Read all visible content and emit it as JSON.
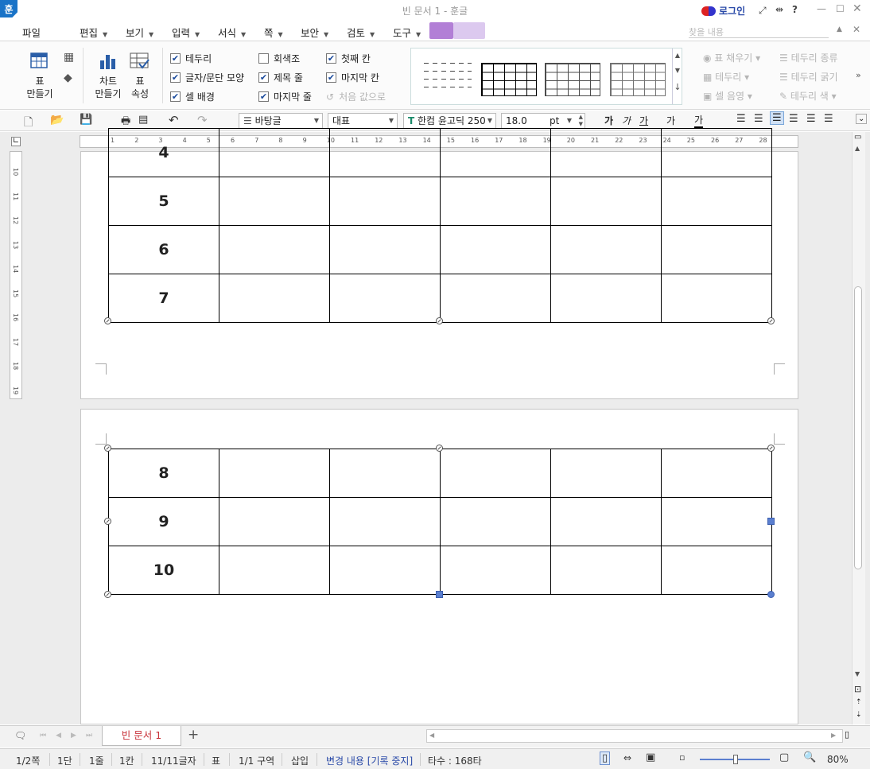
{
  "app": {
    "logo": "훈",
    "window_title": "빈 문서 1 - 훈글",
    "login": "로그인",
    "title_icons": [
      "fullscreen-icon",
      "resize-icon",
      "help-icon",
      "minimize-icon",
      "maximize-icon",
      "close-icon"
    ],
    "help": "?"
  },
  "menu": {
    "file": "파일",
    "items": [
      "편집",
      "보기",
      "입력",
      "서식",
      "쪽",
      "보안",
      "검토",
      "도구"
    ],
    "search_placeholder": "찾을 내용"
  },
  "ribbon": {
    "table_make": "표\n만들기",
    "chart_make": "차트\n만들기",
    "table_props": "표\n속성",
    "checks": [
      {
        "label": "테두리",
        "checked": true
      },
      {
        "label": "글자/문단 모양",
        "checked": true
      },
      {
        "label": "셀 배경",
        "checked": true
      },
      {
        "label": "회색조",
        "checked": false
      },
      {
        "label": "제목 줄",
        "checked": true
      },
      {
        "label": "마지막 줄",
        "checked": true
      },
      {
        "label": "첫째 칸",
        "checked": true
      },
      {
        "label": "마지막 칸",
        "checked": true
      }
    ],
    "reset": "처음 값으로",
    "right_tools": [
      "표 채우기",
      "테두리",
      "셀 음영",
      "테두리 종류",
      "테두리 굵기",
      "테두리 색"
    ]
  },
  "format": {
    "style": "바탕글",
    "lang": "대표",
    "font": "한컴 윤고딕 250",
    "size": "18.0",
    "unit": "pt",
    "char_buttons": [
      "가",
      "가",
      "가",
      "가",
      "가"
    ]
  },
  "ruler": {
    "h_ticks": [
      "1",
      "2",
      "3",
      "4",
      "5",
      "6",
      "7",
      "8",
      "9",
      "10",
      "11",
      "12",
      "13",
      "14",
      "15",
      "16",
      "17",
      "18",
      "19",
      "20",
      "21",
      "22",
      "23",
      "24",
      "25",
      "26",
      "27",
      "28"
    ],
    "v_ticks": [
      "10",
      "11",
      "12",
      "13",
      "14",
      "15",
      "16",
      "17",
      "18",
      "19"
    ]
  },
  "page1_rows": [
    "4",
    "5",
    "6",
    "7"
  ],
  "page2_rows": [
    "8",
    "9",
    "10"
  ],
  "tabs": {
    "doc": "빈 문서 1",
    "add": "+"
  },
  "status": {
    "page": "1/2쪽",
    "col": "1단",
    "line": "1줄",
    "cell": "1칸",
    "chars": "11/11글자",
    "mode": "표",
    "section": "1/1 구역",
    "insert": "삽입",
    "track": "변경 내용 [기록 중지]",
    "typing": "타수 : 168타",
    "zoom": "80%"
  },
  "colors": {
    "accent": "#1a73c7",
    "purple": "#b27fd6",
    "tab_text": "#c8333a",
    "selection_handle": "#5b7fcf"
  }
}
